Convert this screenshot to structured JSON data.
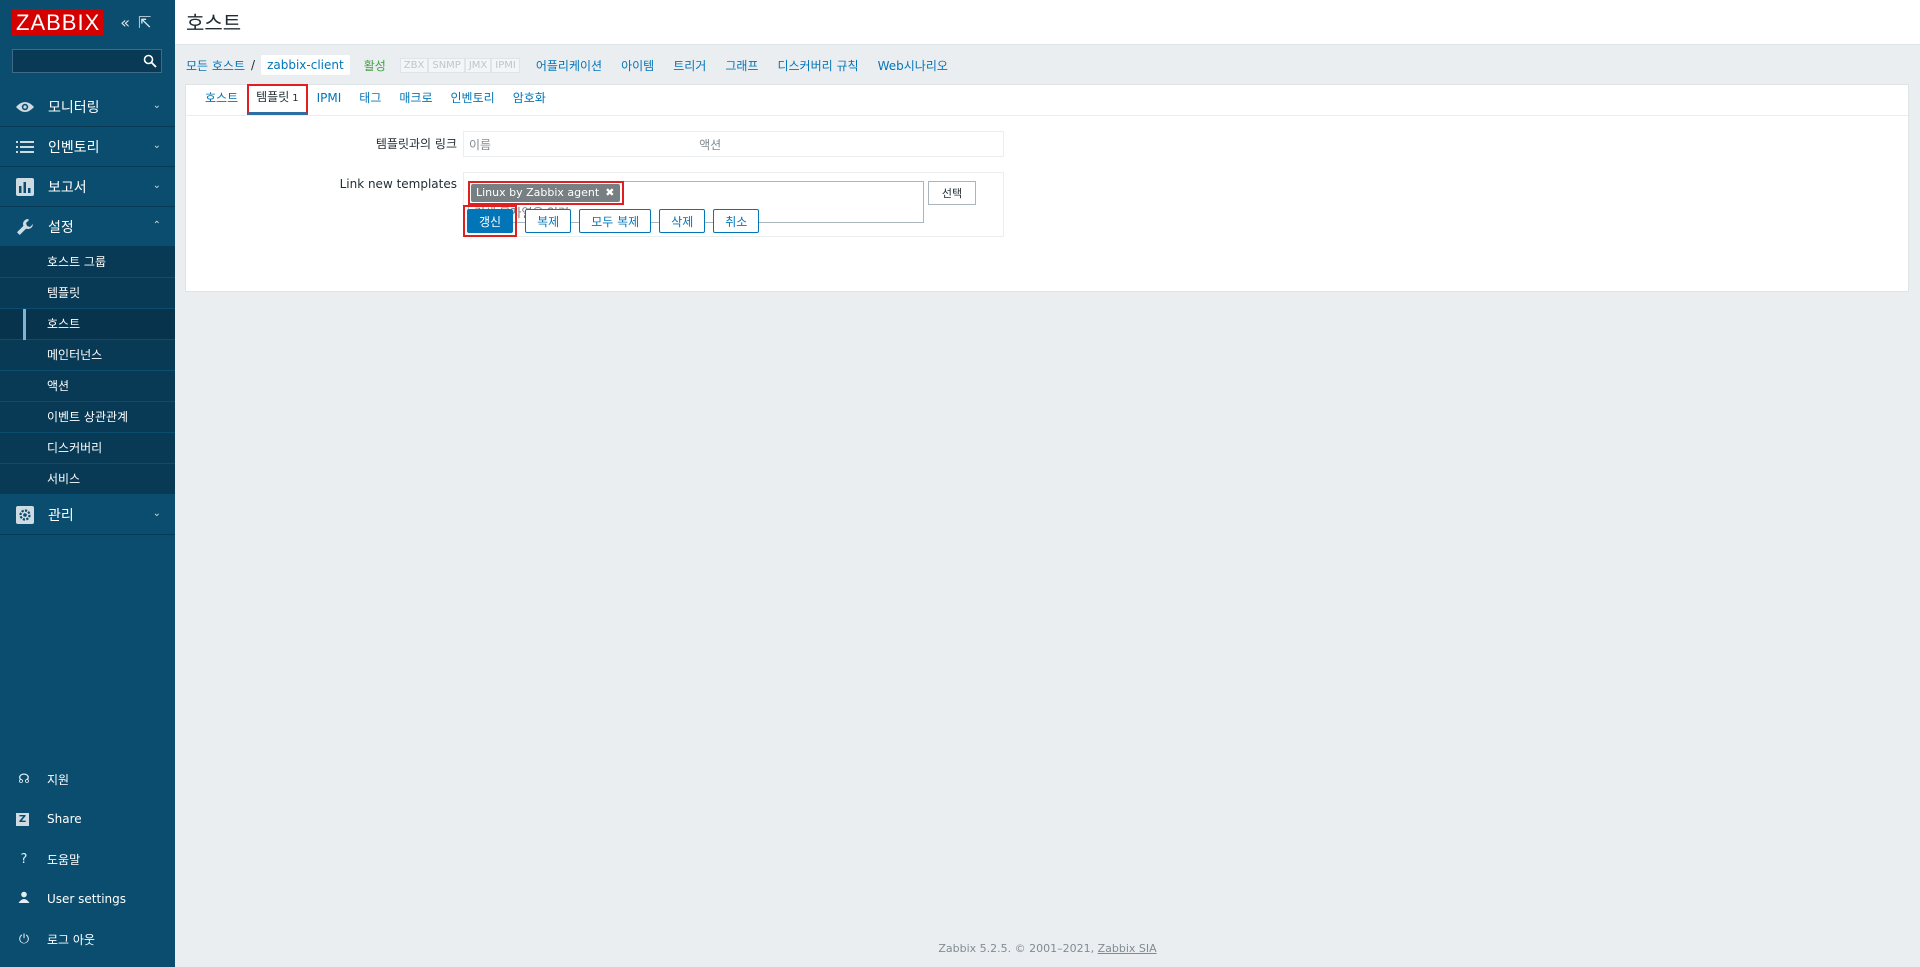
{
  "brand": {
    "logo": "ZABBIX"
  },
  "sidebar": {
    "search": {
      "placeholder": ""
    },
    "menu": [
      {
        "label": "모니터링",
        "icon": "eye-icon"
      },
      {
        "label": "인벤토리",
        "icon": "list-icon"
      },
      {
        "label": "보고서",
        "icon": "bar-chart-icon"
      },
      {
        "label": "설정",
        "icon": "wrench-icon"
      },
      {
        "label": "관리",
        "icon": "gear-icon"
      }
    ],
    "config_submenu": [
      "호스트 그룹",
      "템플릿",
      "호스트",
      "메인터넌스",
      "액션",
      "이벤트 상관관계",
      "디스커버리",
      "서비스"
    ],
    "bottom": [
      {
        "label": "지원",
        "icon": "headset-icon"
      },
      {
        "label": "Share",
        "icon": "share-icon"
      },
      {
        "label": "도움말",
        "icon": "help-icon"
      },
      {
        "label": "User settings",
        "icon": "user-icon"
      },
      {
        "label": "로그 아웃",
        "icon": "power-icon"
      }
    ]
  },
  "header": {
    "title": "호스트"
  },
  "breadcrumb": {
    "all_hosts": "모든 호스트",
    "sep": "/",
    "current": "zabbix-client",
    "status": "활성",
    "availability": [
      "ZBX",
      "SNMP",
      "JMX",
      "IPMI"
    ],
    "links": [
      "어플리케이션",
      "아이템",
      "트리거",
      "그래프",
      "디스커버리 규칙",
      "Web시나리오"
    ]
  },
  "tabs": {
    "items": [
      "호스트",
      "템플릿",
      "IPMI",
      "태그",
      "매크로",
      "인벤토리",
      "암호화"
    ],
    "templates_count": "1"
  },
  "form": {
    "linked_label": "템플릿과의 링크",
    "linked_col_name": "이름",
    "linked_col_action": "액션",
    "new_label": "Link new templates",
    "chip": "Linux by Zabbix agent",
    "search_placeholder": "검색 문자열을 입력",
    "select_button": "선택"
  },
  "buttons": {
    "update": "갱신",
    "clone": "복제",
    "full_clone": "모두 복제",
    "delete": "삭제",
    "cancel": "취소"
  },
  "footer": {
    "text": "Zabbix 5.2.5. © 2001–2021, ",
    "link": "Zabbix SIA"
  },
  "colors": {
    "sidebar": "#0b4d6e",
    "accent": "#0275b8",
    "highlight": "#e02020",
    "logo": "#d40000"
  }
}
